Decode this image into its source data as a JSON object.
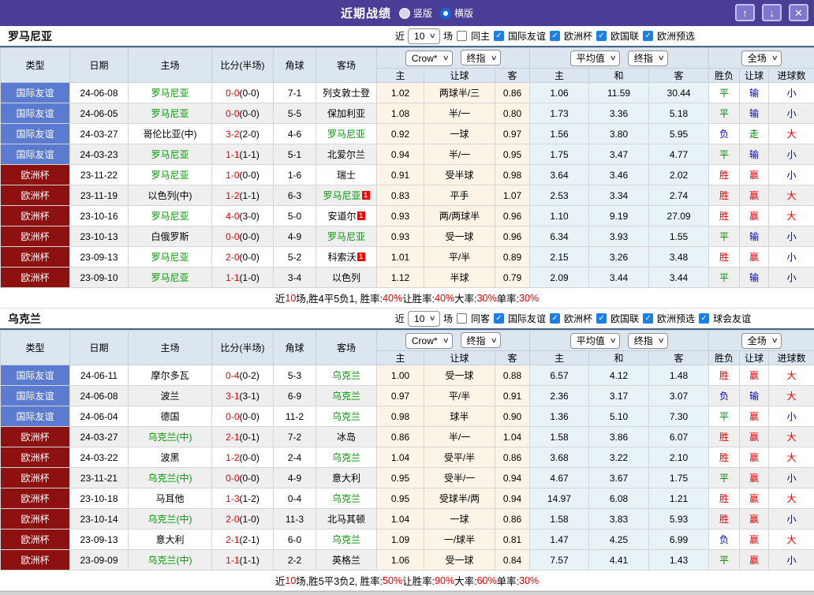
{
  "icons": {
    "chevron": "∨",
    "check": "✓",
    "up": "↑",
    "down": "↓",
    "close": "✕"
  },
  "colors": {
    "accent_purple": "#4a3d96",
    "type_blue": "#5b7bd0",
    "type_red": "#8e1111",
    "team_green": "#009900",
    "score_red": "#e80000",
    "lose_blue": "#0000dd",
    "draw_green": "#008800",
    "crow_bg": "#fdf4e8",
    "avg_bg": "#e8f3f8"
  },
  "titlebar": {
    "title": "近期战绩",
    "radios": [
      {
        "label": "竖版",
        "selected": false
      },
      {
        "label": "横版",
        "selected": true
      }
    ]
  },
  "filter": {
    "near": "近",
    "count": "10",
    "games": "场"
  },
  "headers": {
    "type": "类型",
    "date": "日期",
    "home": "主场",
    "score": "比分(半场)",
    "corner": "角球",
    "away": "客场",
    "crow": "Crow*",
    "final": "终指",
    "avg": "平均值",
    "full": "全场",
    "sub_home": "主",
    "sub_handicap": "让球",
    "sub_away": "客",
    "sub_avg_home": "主",
    "sub_draw": "和",
    "sub_avg_away": "客",
    "sub_wdl": "胜负",
    "sub_handicap2": "让球",
    "sub_goals": "进球数"
  },
  "sections": [
    {
      "team": "罗马尼亚",
      "same": "同主",
      "comps": [
        "国际友谊",
        "欧洲杯",
        "欧国联",
        "欧洲预选"
      ],
      "rows": [
        {
          "type": "国际友谊",
          "tc": "b",
          "date": "24-06-08",
          "home": "罗马尼亚",
          "hg": 1,
          "hb": "",
          "score": "0-0",
          "half": "(0-0)",
          "corner": "7-1",
          "away": "列支敦士登",
          "ag": 0,
          "ab": "",
          "o1": "1.02",
          "hd": "两球半/三",
          "o2": "0.86",
          "m1": "1.06",
          "m2": "11.59",
          "m3": "30.44",
          "r1": "平",
          "k1": "g",
          "r2": "输",
          "k2": "b",
          "r3": "小",
          "k3": "b"
        },
        {
          "type": "国际友谊",
          "tc": "b",
          "date": "24-06-05",
          "home": "罗马尼亚",
          "hg": 1,
          "hb": "",
          "score": "0-0",
          "half": "(0-0)",
          "corner": "5-5",
          "away": "保加利亚",
          "ag": 0,
          "ab": "",
          "o1": "1.08",
          "hd": "半/一",
          "o2": "0.80",
          "m1": "1.73",
          "m2": "3.36",
          "m3": "5.18",
          "r1": "平",
          "k1": "g",
          "r2": "输",
          "k2": "b",
          "r3": "小",
          "k3": "b"
        },
        {
          "type": "国际友谊",
          "tc": "b",
          "date": "24-03-27",
          "home": "哥伦比亚(中)",
          "hg": 0,
          "hb": "",
          "score": "3-2",
          "half": "(2-0)",
          "corner": "4-6",
          "away": "罗马尼亚",
          "ag": 1,
          "ab": "",
          "o1": "0.92",
          "hd": "一球",
          "o2": "0.97",
          "m1": "1.56",
          "m2": "3.80",
          "m3": "5.95",
          "r1": "负",
          "k1": "b",
          "r2": "走",
          "k2": "g",
          "r3": "大",
          "k3": "r"
        },
        {
          "type": "国际友谊",
          "tc": "b",
          "date": "24-03-23",
          "home": "罗马尼亚",
          "hg": 1,
          "hb": "",
          "score": "1-1",
          "half": "(1-1)",
          "corner": "5-1",
          "away": "北爱尔兰",
          "ag": 0,
          "ab": "",
          "o1": "0.94",
          "hd": "半/一",
          "o2": "0.95",
          "m1": "1.75",
          "m2": "3.47",
          "m3": "4.77",
          "r1": "平",
          "k1": "g",
          "r2": "输",
          "k2": "b",
          "r3": "小",
          "k3": "b"
        },
        {
          "type": "欧洲杯",
          "tc": "r",
          "date": "23-11-22",
          "home": "罗马尼亚",
          "hg": 1,
          "hb": "",
          "score": "1-0",
          "half": "(0-0)",
          "corner": "1-6",
          "away": "瑞士",
          "ag": 0,
          "ab": "",
          "o1": "0.91",
          "hd": "受半球",
          "o2": "0.98",
          "m1": "3.64",
          "m2": "3.46",
          "m3": "2.02",
          "r1": "胜",
          "k1": "r",
          "r2": "赢",
          "k2": "r",
          "r3": "小",
          "k3": "b"
        },
        {
          "type": "欧洲杯",
          "tc": "r",
          "date": "23-11-19",
          "home": "以色列(中)",
          "hg": 0,
          "hb": "",
          "score": "1-2",
          "half": "(1-1)",
          "corner": "6-3",
          "away": "罗马尼亚",
          "ag": 1,
          "ab": "1",
          "o1": "0.83",
          "hd": "平手",
          "o2": "1.07",
          "m1": "2.53",
          "m2": "3.34",
          "m3": "2.74",
          "r1": "胜",
          "k1": "r",
          "r2": "赢",
          "k2": "r",
          "r3": "大",
          "k3": "r"
        },
        {
          "type": "欧洲杯",
          "tc": "r",
          "date": "23-10-16",
          "home": "罗马尼亚",
          "hg": 1,
          "hb": "",
          "score": "4-0",
          "half": "(3-0)",
          "corner": "5-0",
          "away": "安道尔",
          "ag": 0,
          "ab": "1",
          "o1": "0.93",
          "hd": "两/两球半",
          "o2": "0.96",
          "m1": "1.10",
          "m2": "9.19",
          "m3": "27.09",
          "r1": "胜",
          "k1": "r",
          "r2": "赢",
          "k2": "r",
          "r3": "大",
          "k3": "r"
        },
        {
          "type": "欧洲杯",
          "tc": "r",
          "date": "23-10-13",
          "home": "白俄罗斯",
          "hg": 0,
          "hb": "",
          "score": "0-0",
          "half": "(0-0)",
          "corner": "4-9",
          "away": "罗马尼亚",
          "ag": 1,
          "ab": "",
          "o1": "0.93",
          "hd": "受一球",
          "o2": "0.96",
          "m1": "6.34",
          "m2": "3.93",
          "m3": "1.55",
          "r1": "平",
          "k1": "g",
          "r2": "输",
          "k2": "b",
          "r3": "小",
          "k3": "b"
        },
        {
          "type": "欧洲杯",
          "tc": "r",
          "date": "23-09-13",
          "home": "罗马尼亚",
          "hg": 1,
          "hb": "",
          "score": "2-0",
          "half": "(0-0)",
          "corner": "5-2",
          "away": "科索沃",
          "ag": 0,
          "ab": "1",
          "o1": "1.01",
          "hd": "平/半",
          "o2": "0.89",
          "m1": "2.15",
          "m2": "3.26",
          "m3": "3.48",
          "r1": "胜",
          "k1": "r",
          "r2": "赢",
          "k2": "r",
          "r3": "小",
          "k3": "b"
        },
        {
          "type": "欧洲杯",
          "tc": "r",
          "date": "23-09-10",
          "home": "罗马尼亚",
          "hg": 1,
          "hb": "",
          "score": "1-1",
          "half": "(1-0)",
          "corner": "3-4",
          "away": "以色列",
          "ag": 0,
          "ab": "",
          "o1": "1.12",
          "hd": "半球",
          "o2": "0.79",
          "m1": "2.09",
          "m2": "3.44",
          "m3": "3.44",
          "r1": "平",
          "k1": "g",
          "r2": "输",
          "k2": "b",
          "r3": "小",
          "k3": "b"
        }
      ],
      "summary": [
        {
          "t": "近",
          "r": false
        },
        {
          "t": "10",
          "r": true
        },
        {
          "t": "场,胜4平5负1, 胜率:",
          "r": false
        },
        {
          "t": "40%",
          "r": true
        },
        {
          "t": " 让胜率:",
          "r": false
        },
        {
          "t": "40%",
          "r": true
        },
        {
          "t": " 大率:",
          "r": false
        },
        {
          "t": "30%",
          "r": true
        },
        {
          "t": " 单率:",
          "r": false
        },
        {
          "t": "30%",
          "r": true
        }
      ]
    },
    {
      "team": "乌克兰",
      "same": "同客",
      "comps": [
        "国际友谊",
        "欧洲杯",
        "欧国联",
        "欧洲预选",
        "球会友谊"
      ],
      "rows": [
        {
          "type": "国际友谊",
          "tc": "b",
          "date": "24-06-11",
          "home": "摩尔多瓦",
          "hg": 0,
          "hb": "",
          "score": "0-4",
          "half": "(0-2)",
          "corner": "5-3",
          "away": "乌克兰",
          "ag": 1,
          "ab": "",
          "o1": "1.00",
          "hd": "受一球",
          "o2": "0.88",
          "m1": "6.57",
          "m2": "4.12",
          "m3": "1.48",
          "r1": "胜",
          "k1": "r",
          "r2": "赢",
          "k2": "r",
          "r3": "大",
          "k3": "r"
        },
        {
          "type": "国际友谊",
          "tc": "b",
          "date": "24-06-08",
          "home": "波兰",
          "hg": 0,
          "hb": "",
          "score": "3-1",
          "half": "(3-1)",
          "corner": "6-9",
          "away": "乌克兰",
          "ag": 1,
          "ab": "",
          "o1": "0.97",
          "hd": "平/半",
          "o2": "0.91",
          "m1": "2.36",
          "m2": "3.17",
          "m3": "3.07",
          "r1": "负",
          "k1": "b",
          "r2": "输",
          "k2": "b",
          "r3": "大",
          "k3": "r"
        },
        {
          "type": "国际友谊",
          "tc": "b",
          "date": "24-06-04",
          "home": "德国",
          "hg": 0,
          "hb": "",
          "score": "0-0",
          "half": "(0-0)",
          "corner": "11-2",
          "away": "乌克兰",
          "ag": 1,
          "ab": "",
          "o1": "0.98",
          "hd": "球半",
          "o2": "0.90",
          "m1": "1.36",
          "m2": "5.10",
          "m3": "7.30",
          "r1": "平",
          "k1": "g",
          "r2": "赢",
          "k2": "r",
          "r3": "小",
          "k3": "b"
        },
        {
          "type": "欧洲杯",
          "tc": "r",
          "date": "24-03-27",
          "home": "乌克兰(中)",
          "hg": 1,
          "hb": "",
          "score": "2-1",
          "half": "(0-1)",
          "corner": "7-2",
          "away": "冰岛",
          "ag": 0,
          "ab": "",
          "o1": "0.86",
          "hd": "半/一",
          "o2": "1.04",
          "m1": "1.58",
          "m2": "3.86",
          "m3": "6.07",
          "r1": "胜",
          "k1": "r",
          "r2": "赢",
          "k2": "r",
          "r3": "大",
          "k3": "r"
        },
        {
          "type": "欧洲杯",
          "tc": "r",
          "date": "24-03-22",
          "home": "波黑",
          "hg": 0,
          "hb": "",
          "score": "1-2",
          "half": "(0-0)",
          "corner": "2-4",
          "away": "乌克兰",
          "ag": 1,
          "ab": "",
          "o1": "1.04",
          "hd": "受平/半",
          "o2": "0.86",
          "m1": "3.68",
          "m2": "3.22",
          "m3": "2.10",
          "r1": "胜",
          "k1": "r",
          "r2": "赢",
          "k2": "r",
          "r3": "大",
          "k3": "r"
        },
        {
          "type": "欧洲杯",
          "tc": "r",
          "date": "23-11-21",
          "home": "乌克兰(中)",
          "hg": 1,
          "hb": "",
          "score": "0-0",
          "half": "(0-0)",
          "corner": "4-9",
          "away": "意大利",
          "ag": 0,
          "ab": "",
          "o1": "0.95",
          "hd": "受半/一",
          "o2": "0.94",
          "m1": "4.67",
          "m2": "3.67",
          "m3": "1.75",
          "r1": "平",
          "k1": "g",
          "r2": "赢",
          "k2": "r",
          "r3": "小",
          "k3": "b"
        },
        {
          "type": "欧洲杯",
          "tc": "r",
          "date": "23-10-18",
          "home": "马耳他",
          "hg": 0,
          "hb": "",
          "score": "1-3",
          "half": "(1-2)",
          "corner": "0-4",
          "away": "乌克兰",
          "ag": 1,
          "ab": "",
          "o1": "0.95",
          "hd": "受球半/两",
          "o2": "0.94",
          "m1": "14.97",
          "m2": "6.08",
          "m3": "1.21",
          "r1": "胜",
          "k1": "r",
          "r2": "赢",
          "k2": "r",
          "r3": "大",
          "k3": "r"
        },
        {
          "type": "欧洲杯",
          "tc": "r",
          "date": "23-10-14",
          "home": "乌克兰(中)",
          "hg": 1,
          "hb": "",
          "score": "2-0",
          "half": "(1-0)",
          "corner": "11-3",
          "away": "北马其顿",
          "ag": 0,
          "ab": "",
          "o1": "1.04",
          "hd": "一球",
          "o2": "0.86",
          "m1": "1.58",
          "m2": "3.83",
          "m3": "5.93",
          "r1": "胜",
          "k1": "r",
          "r2": "赢",
          "k2": "r",
          "r3": "小",
          "k3": "b"
        },
        {
          "type": "欧洲杯",
          "tc": "r",
          "date": "23-09-13",
          "home": "意大利",
          "hg": 0,
          "hb": "",
          "score": "2-1",
          "half": "(2-1)",
          "corner": "6-0",
          "away": "乌克兰",
          "ag": 1,
          "ab": "",
          "o1": "1.09",
          "hd": "一/球半",
          "o2": "0.81",
          "m1": "1.47",
          "m2": "4.25",
          "m3": "6.99",
          "r1": "负",
          "k1": "b",
          "r2": "赢",
          "k2": "r",
          "r3": "大",
          "k3": "r"
        },
        {
          "type": "欧洲杯",
          "tc": "r",
          "date": "23-09-09",
          "home": "乌克兰(中)",
          "hg": 1,
          "hb": "",
          "score": "1-1",
          "half": "(1-1)",
          "corner": "2-2",
          "away": "英格兰",
          "ag": 0,
          "ab": "",
          "o1": "1.06",
          "hd": "受一球",
          "o2": "0.84",
          "m1": "7.57",
          "m2": "4.41",
          "m3": "1.43",
          "r1": "平",
          "k1": "g",
          "r2": "赢",
          "k2": "r",
          "r3": "小",
          "k3": "b"
        }
      ],
      "summary": [
        {
          "t": "近",
          "r": false
        },
        {
          "t": "10",
          "r": true
        },
        {
          "t": "场,胜5平3负2, 胜率:",
          "r": false
        },
        {
          "t": "50%",
          "r": true
        },
        {
          "t": " 让胜率:",
          "r": false
        },
        {
          "t": "90%",
          "r": true
        },
        {
          "t": " 大率:",
          "r": false
        },
        {
          "t": "60%",
          "r": true
        },
        {
          "t": " 单率:",
          "r": false
        },
        {
          "t": "30%",
          "r": true
        }
      ]
    }
  ]
}
